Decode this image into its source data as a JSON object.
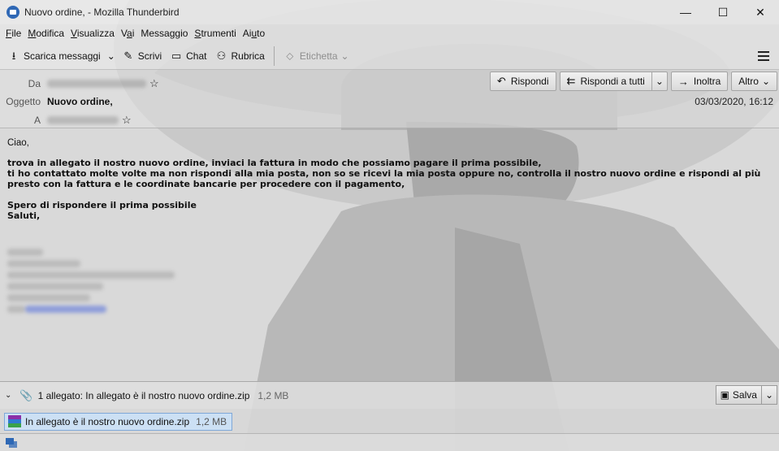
{
  "window": {
    "title": "Nuovo ordine, - Mozilla Thunderbird",
    "minimize": "—",
    "maximize": "☐",
    "close": "✕"
  },
  "menu": {
    "items": [
      {
        "underline": "F",
        "rest": "ile"
      },
      {
        "underline": "M",
        "rest": "odifica"
      },
      {
        "underline": "V",
        "rest": "isualizza"
      },
      {
        "pre": "V",
        "underline": "a",
        "rest": "i"
      },
      {
        "pre": "Messag",
        "underline": "g",
        "rest": "io"
      },
      {
        "underline": "S",
        "rest": "trumenti"
      },
      {
        "pre": "Ai",
        "underline": "u",
        "rest": "to"
      }
    ]
  },
  "toolbar": {
    "get_messages": "Scarica messaggi",
    "write": "Scrivi",
    "chat": "Chat",
    "address_book": "Rubrica",
    "tag": "Etichetta"
  },
  "header": {
    "from_label": "Da",
    "subject_label": "Oggetto",
    "to_label": "A",
    "subject": "Nuovo ordine,",
    "date": "03/03/2020, 16:12",
    "reply": "Rispondi",
    "reply_all": "Rispondi a tutti",
    "forward": "Inoltra",
    "more": "Altro"
  },
  "body": {
    "greeting": "Ciao,",
    "line1": "trova in allegato il nostro nuovo ordine, inviaci la fattura in modo che possiamo pagare il prima possibile,",
    "line2": "ti ho contattato molte volte ma non rispondi alla mia posta, non so se ricevi la mia posta oppure no, controlla il nostro nuovo ordine e rispondi al più presto con la fattura e le coordinate bancarie per procedere con il pagamento,",
    "line3": "Spero di rispondere il prima possibile",
    "line4": "Saluti,"
  },
  "attachments": {
    "summary": "1 allegato: In allegato è il nostro nuovo ordine.zip",
    "summary_size": "1,2 MB",
    "save": "Salva",
    "file_name": "In allegato è il nostro nuovo ordine.zip",
    "file_size": "1,2 MB"
  },
  "colors": {
    "accent": "#2f68b5",
    "selection": "#cce0f4"
  }
}
